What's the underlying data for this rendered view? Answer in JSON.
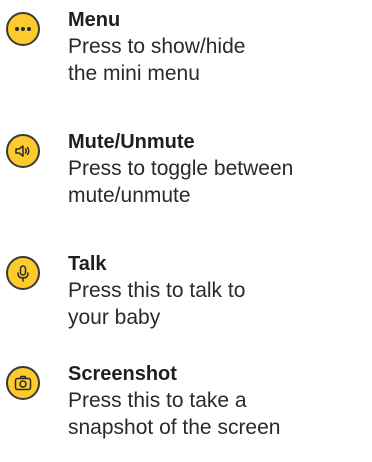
{
  "items": [
    {
      "icon": "more-dots-icon",
      "title": "Menu",
      "lines": [
        "Press to show/hide",
        "the mini menu"
      ]
    },
    {
      "icon": "speaker-icon",
      "title": "Mute/Unmute",
      "lines": [
        "Press to toggle between",
        "mute/unmute"
      ]
    },
    {
      "icon": "microphone-icon",
      "title": "Talk",
      "lines": [
        "Press this to talk to",
        "your baby"
      ]
    },
    {
      "icon": "camera-icon",
      "title": "Screenshot",
      "lines": [
        "Press this to take a",
        "snapshot of the screen"
      ]
    }
  ],
  "colors": {
    "icon_fill": "#FDCB2B",
    "icon_stroke": "#3a3a3a",
    "text": "#1f1f1f"
  }
}
